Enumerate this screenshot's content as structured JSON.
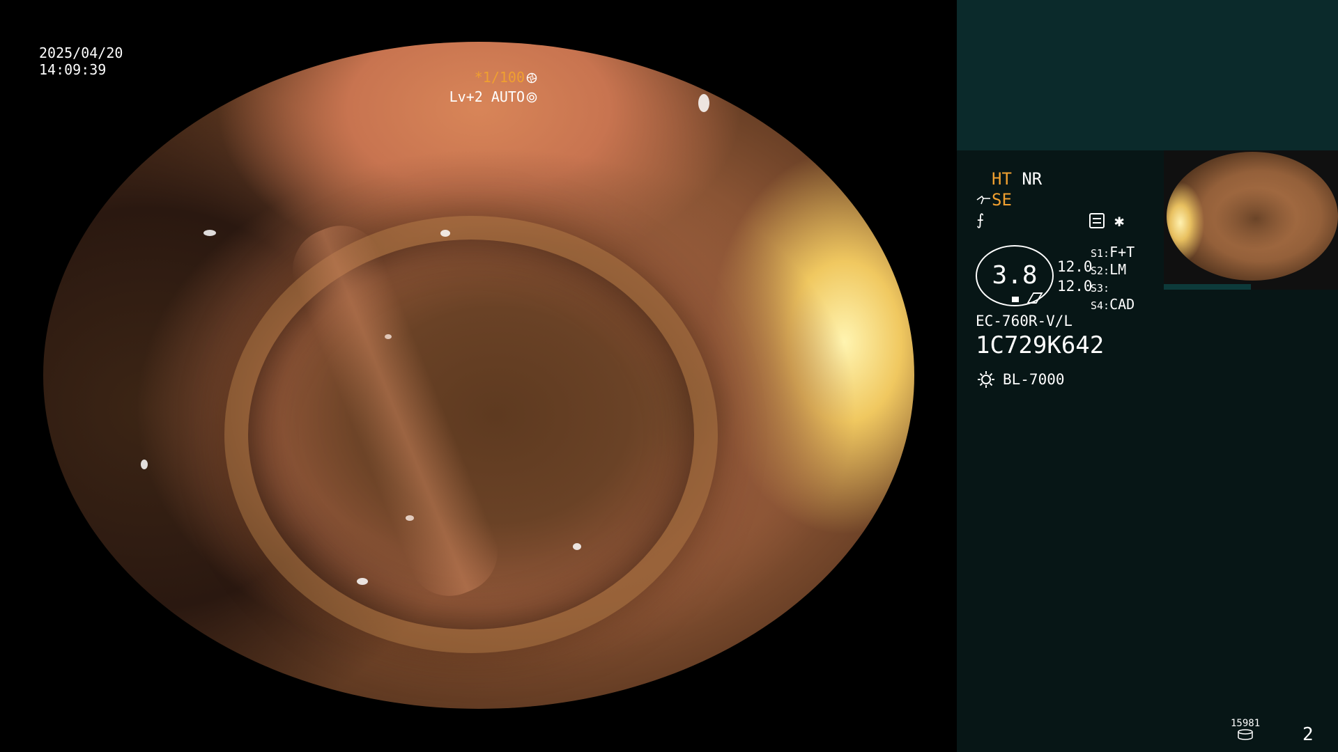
{
  "osd": {
    "date": "2025/04/20",
    "time": "14:09:39",
    "zoom": "*1/100",
    "level": "Lv+2 AUTO"
  },
  "panel": {
    "ht": "HT",
    "nr": "NR",
    "se": "SE",
    "gauge_value": "3.8",
    "value_1": "12.0",
    "value_2": "12.0",
    "switches": [
      {
        "key": "S1:",
        "value": "F+T"
      },
      {
        "key": "S2:",
        "value": "LM"
      },
      {
        "key": "S3:",
        "value": ""
      },
      {
        "key": "S4:",
        "value": "CAD"
      }
    ],
    "scope_model": "EC-760R-V/L",
    "scope_serial": "1C729K642",
    "lamp_model": "BL-7000",
    "counter": "15981",
    "page_number": "2"
  },
  "colors": {
    "accent_orange": "#f0a030",
    "panel_bg": "#071616",
    "panel_top_bg": "#0b2a2b"
  },
  "icons": [
    "aperture-icon",
    "auto-iris-icon",
    "scope-icon",
    "curve-icon",
    "settings-icon",
    "asterisk-icon",
    "lamp-icon",
    "disk-icon"
  ]
}
